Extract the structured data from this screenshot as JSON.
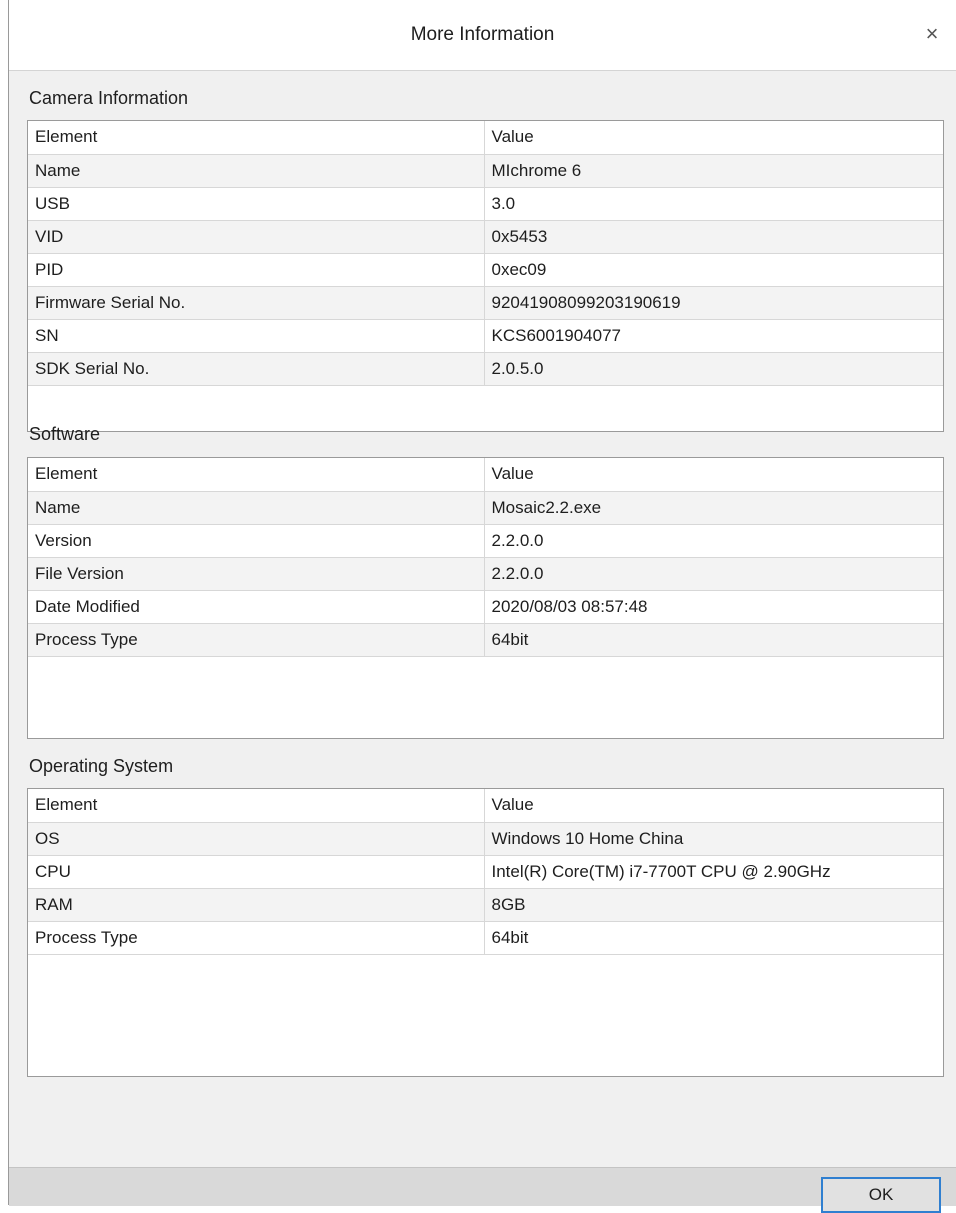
{
  "window": {
    "title": "More Information",
    "close_icon": "close-icon",
    "close_glyph": "×"
  },
  "sections": [
    {
      "label": "Camera Information",
      "header": [
        "Element",
        "Value"
      ],
      "rows": [
        [
          "Name",
          "MIchrome 6"
        ],
        [
          "USB",
          "3.0"
        ],
        [
          "VID",
          "0x5453"
        ],
        [
          "PID",
          "0xec09"
        ],
        [
          "Firmware Serial No.",
          "92041908099203190619"
        ],
        [
          "SN",
          "KCS6001904077"
        ],
        [
          "SDK Serial No.",
          "2.0.5.0"
        ]
      ]
    },
    {
      "label": "Software",
      "header": [
        "Element",
        "Value"
      ],
      "rows": [
        [
          "Name",
          "Mosaic2.2.exe"
        ],
        [
          "Version",
          "2.2.0.0"
        ],
        [
          "File Version",
          "2.2.0.0"
        ],
        [
          "Date Modified",
          "2020/08/03 08:57:48"
        ],
        [
          "Process Type",
          "64bit"
        ]
      ]
    },
    {
      "label": "Operating System",
      "header": [
        "Element",
        "Value"
      ],
      "rows": [
        [
          "OS",
          "Windows 10 Home China"
        ],
        [
          "CPU",
          "Intel(R) Core(TM) i7-7700T CPU @ 2.90GHz"
        ],
        [
          "RAM",
          "8GB"
        ],
        [
          "Process Type",
          "64bit"
        ]
      ]
    }
  ],
  "footer": {
    "ok_label": "OK"
  }
}
